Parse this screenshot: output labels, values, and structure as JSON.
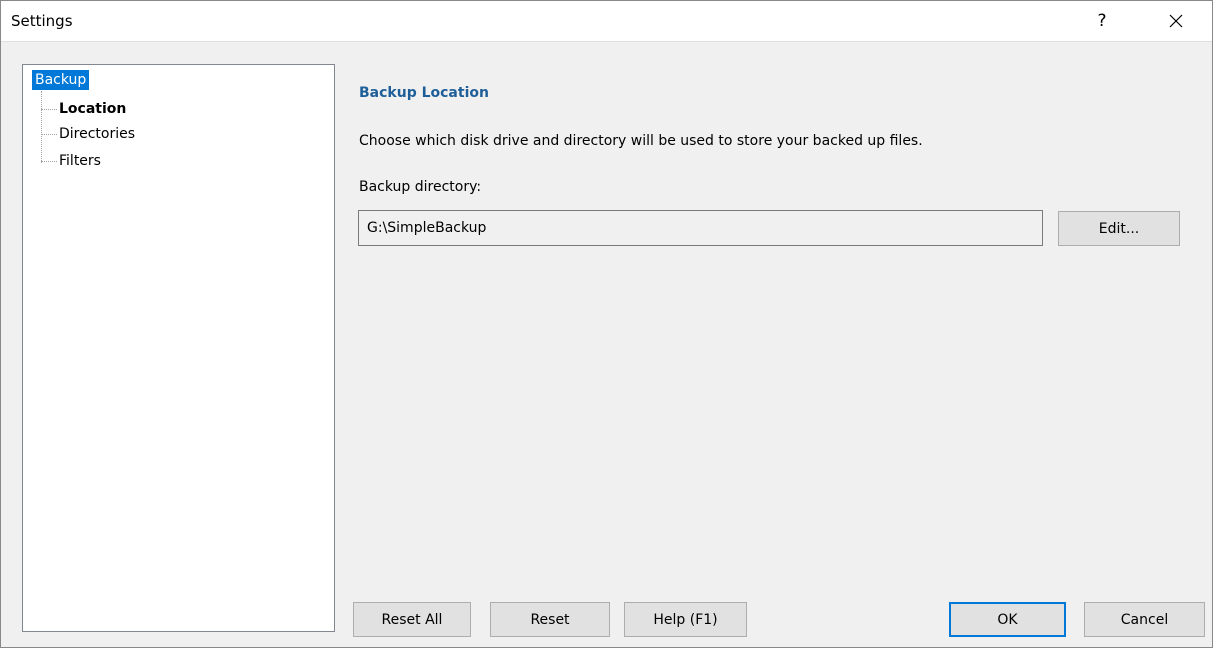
{
  "window": {
    "title": "Settings",
    "help_label": "?",
    "close_icon": "close-icon"
  },
  "tree": {
    "root": "Backup",
    "children": [
      {
        "label": "Location",
        "selected": true
      },
      {
        "label": "Directories",
        "selected": false
      },
      {
        "label": "Filters",
        "selected": false
      }
    ]
  },
  "panel": {
    "title": "Backup Location",
    "description": "Choose which disk drive and directory will be used to store your backed up files.",
    "dir_label": "Backup directory:",
    "dir_value": "G:\\SimpleBackup",
    "edit_label": "Edit..."
  },
  "buttons": {
    "reset_all": "Reset All",
    "reset": "Reset",
    "help": "Help (F1)",
    "ok": "OK",
    "cancel": "Cancel"
  },
  "colors": {
    "selection": "#0078d7",
    "section_title": "#1f5f99"
  }
}
